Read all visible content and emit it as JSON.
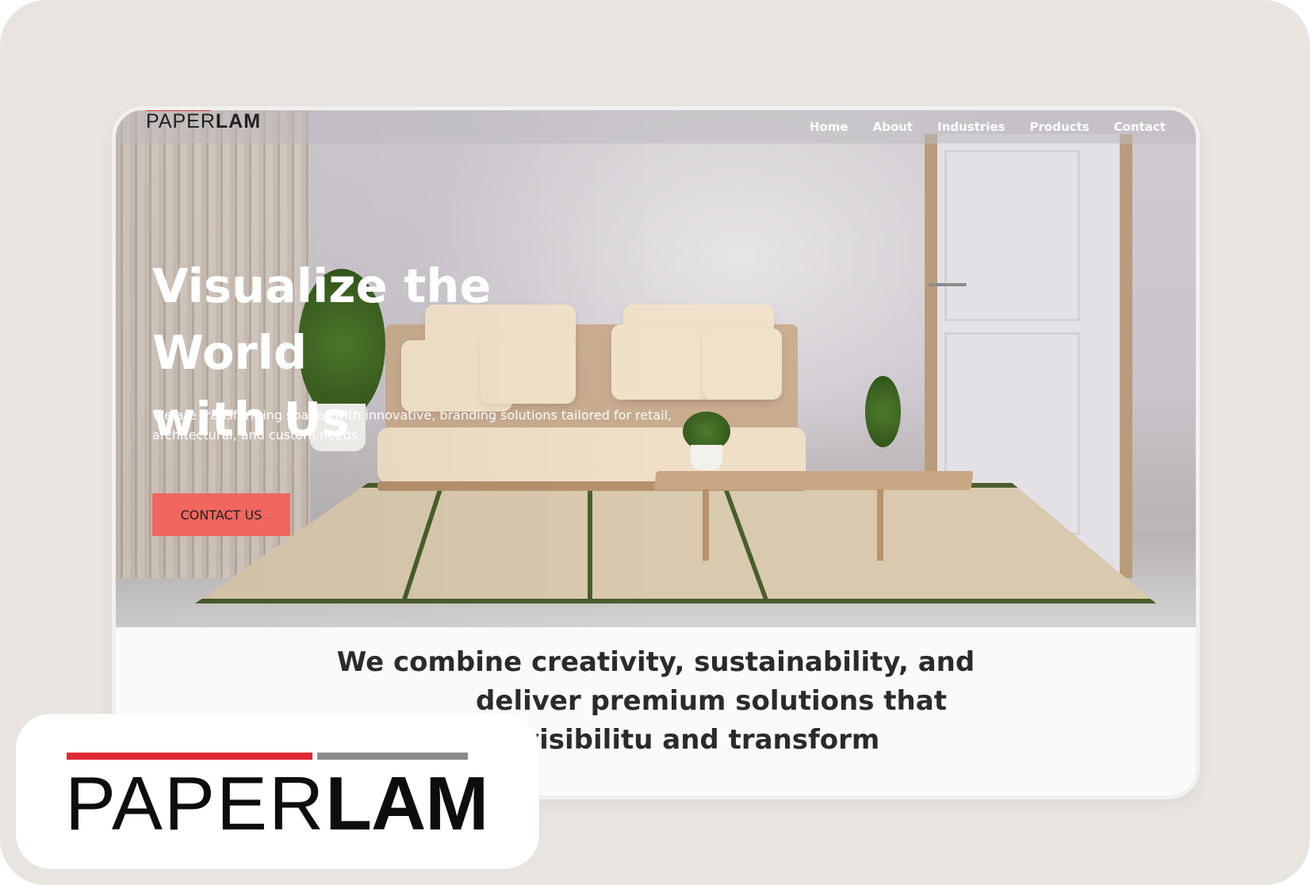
{
  "site": {
    "logo_text_light": "PAPER",
    "logo_text_bold": "LAM"
  },
  "nav": {
    "items": [
      "Home",
      "About",
      "Industries",
      "Products",
      "Contact"
    ]
  },
  "hero": {
    "title_line1": "Visualize the World",
    "title_line2": "with Us",
    "subtitle": "We are transforming spaces with innovative, branding solutions tailored for retail, architectural, and custom needs.",
    "cta_label": "CONTACT US"
  },
  "intro": {
    "line1": "We combine creativity, sustainability, and",
    "line2": "deliver premium solutions that",
    "line3": "and visibilitu and transform"
  },
  "badge": {
    "logo_light": "PAPER",
    "logo_bold": "LAM"
  },
  "colors": {
    "accent": "#f1665f",
    "brand_red": "#e02a33",
    "brand_grey": "#8b8b8b",
    "background": "#e8e5e0"
  }
}
